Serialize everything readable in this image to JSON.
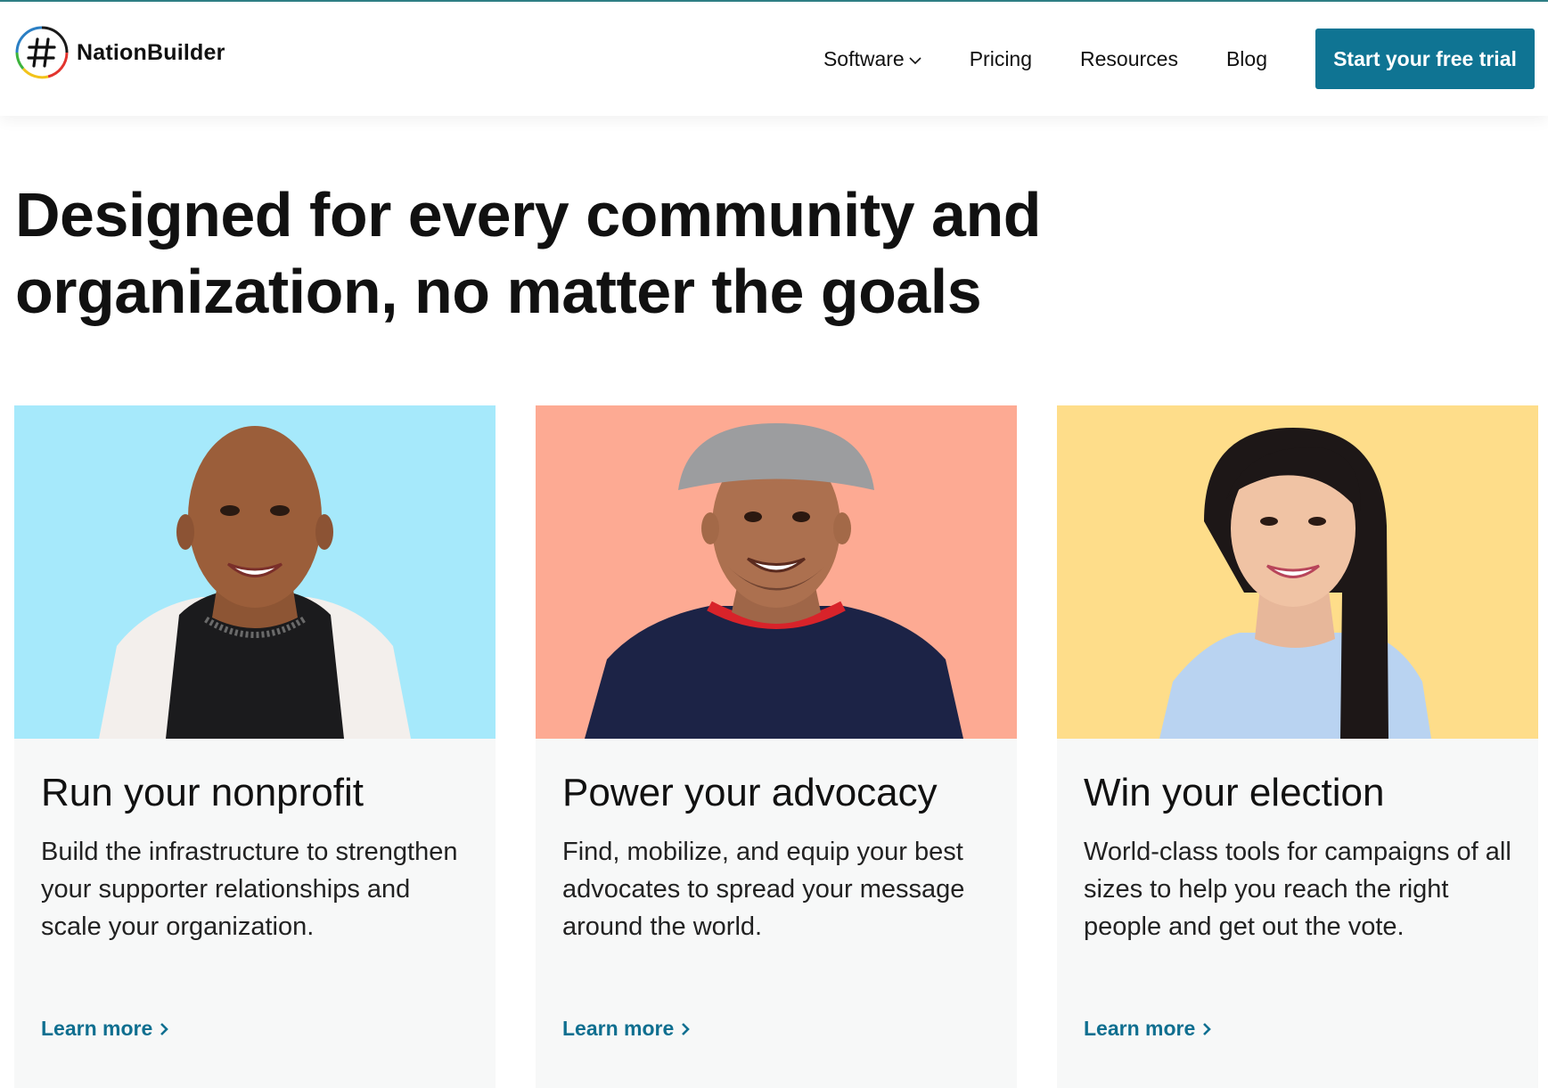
{
  "brand": {
    "name": "NationBuilder",
    "logo_icon": "hash-logo-icon",
    "accent_color": "#0f7493",
    "link_color": "#0f6f90"
  },
  "nav": {
    "items": [
      {
        "label": "Software",
        "has_dropdown": true
      },
      {
        "label": "Pricing"
      },
      {
        "label": "Resources"
      },
      {
        "label": "Blog"
      }
    ],
    "cta_label": "Start your free trial"
  },
  "hero": {
    "title": "Designed for every community and organization, no matter the goals"
  },
  "cards": [
    {
      "title": "Run your nonprofit",
      "description": "Build the infrastructure to strengthen your supporter relationships and scale your organization.",
      "link_label": "Learn more",
      "photo_bg": "#a6e9fb"
    },
    {
      "title": "Power your advocacy",
      "description": "Find, mobilize, and equip your best advocates to spread your message around the world.",
      "link_label": "Learn more",
      "photo_bg": "#fdaa93"
    },
    {
      "title": "Win your election",
      "description": "World-class tools for campaigns of all sizes to help you reach the right people and get out the vote.",
      "link_label": "Learn more",
      "photo_bg": "#fedd8a"
    }
  ]
}
